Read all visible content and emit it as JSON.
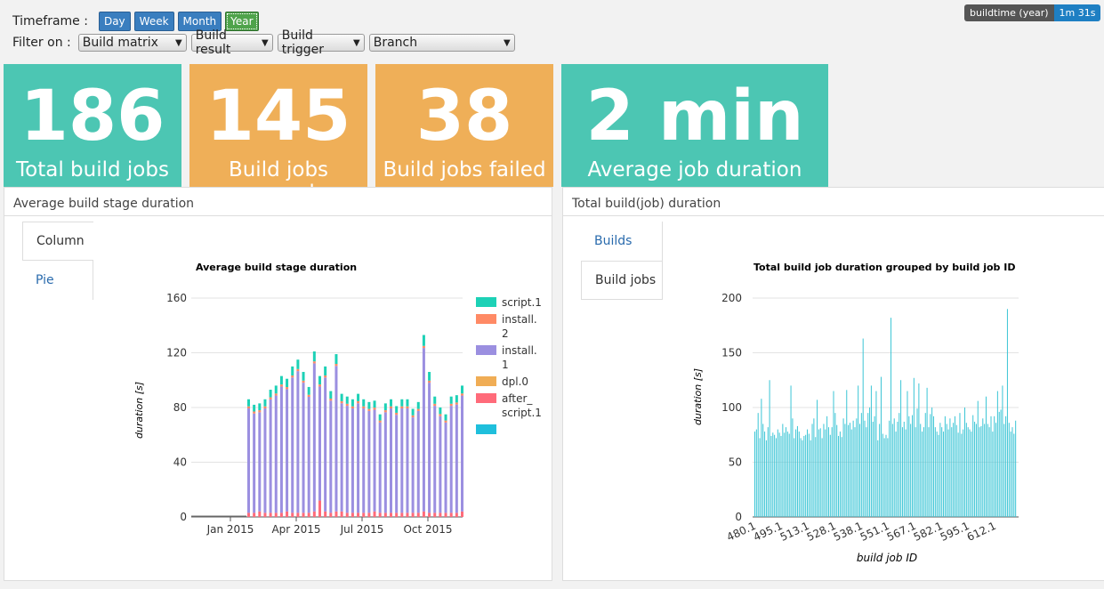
{
  "timeframe": {
    "label": "Timeframe :",
    "buttons": [
      "Day",
      "Week",
      "Month",
      "Year"
    ],
    "active": "Year"
  },
  "filter": {
    "label": "Filter on :",
    "selects": [
      "Build matrix",
      "Build result",
      "Build trigger",
      "Branch"
    ]
  },
  "badge": {
    "key": "buildtime (year)",
    "value": "1m 31s"
  },
  "tiles": [
    {
      "value": "186",
      "caption": "Total build jobs",
      "color": "#4cc6b3"
    },
    {
      "value": "145",
      "caption": "Build jobs passed",
      "color": "#efaf58"
    },
    {
      "value": "38",
      "caption": "Build jobs failed",
      "color": "#efaf58"
    },
    {
      "value": "2 min",
      "caption": "Average job duration",
      "color": "#4cc6b3"
    }
  ],
  "left_panel": {
    "title": "Average build stage duration",
    "tabs": [
      "Column",
      "Pie"
    ],
    "active_tab": "Column"
  },
  "right_panel": {
    "title": "Total build(job) duration",
    "tabs": [
      "Builds",
      "Build jobs"
    ],
    "active_tab": "Build jobs"
  },
  "chart_data": [
    {
      "type": "bar",
      "stacked": true,
      "title": "Average build stage duration",
      "ylabel": "duration [s]",
      "xlabel": "",
      "ylim": [
        0,
        160
      ],
      "yticks": [
        0,
        40,
        80,
        120,
        160
      ],
      "xticks": [
        "Jan 2015",
        "Apr 2015",
        "Jul 2015",
        "Oct 2015"
      ],
      "legend_position": "right",
      "series": [
        {
          "name": "script.1",
          "color": "#1dd1b6"
        },
        {
          "name": "install.\n2",
          "color": "#ff8a65"
        },
        {
          "name": "install.\n1",
          "color": "#9b8fe0"
        },
        {
          "name": "dpl.0",
          "color": "#f0ad55"
        },
        {
          "name": "after_\nscript.1",
          "color": "#ff6b7a"
        },
        {
          "name": "",
          "color": "#1fbfdc"
        }
      ],
      "bars": [
        [
          86,
          3
        ],
        [
          82,
          3
        ],
        [
          83,
          4
        ],
        [
          86,
          3
        ],
        [
          93,
          3
        ],
        [
          96,
          3
        ],
        [
          103,
          3
        ],
        [
          101,
          4
        ],
        [
          110,
          3
        ],
        [
          115,
          3
        ],
        [
          106,
          3
        ],
        [
          95,
          3
        ],
        [
          121,
          4
        ],
        [
          103,
          12
        ],
        [
          110,
          4
        ],
        [
          92,
          3
        ],
        [
          119,
          4
        ],
        [
          90,
          4
        ],
        [
          88,
          3
        ],
        [
          86,
          3
        ],
        [
          90,
          3
        ],
        [
          86,
          3
        ],
        [
          84,
          3
        ],
        [
          85,
          4
        ],
        [
          75,
          3
        ],
        [
          83,
          3
        ],
        [
          86,
          3
        ],
        [
          81,
          3
        ],
        [
          86,
          3
        ],
        [
          86,
          3
        ],
        [
          79,
          3
        ],
        [
          84,
          3
        ],
        [
          133,
          4
        ],
        [
          106,
          3
        ],
        [
          88,
          3
        ],
        [
          80,
          3
        ],
        [
          75,
          3
        ],
        [
          88,
          3
        ],
        [
          89,
          3
        ],
        [
          96,
          4
        ]
      ]
    },
    {
      "type": "bar",
      "title": "Total build job duration grouped by build job ID",
      "ylabel": "duration [s]",
      "xlabel": "build job ID",
      "ylim": [
        0,
        200
      ],
      "yticks": [
        0,
        50,
        100,
        150,
        200
      ],
      "xticks": [
        "480.1",
        "495.1",
        "513.1",
        "528.1",
        "538.1",
        "551.1",
        "567.1",
        "582.1",
        "595.1",
        "612.1"
      ],
      "color": "#3ec6d6",
      "values": [
        78,
        80,
        95,
        72,
        108,
        85,
        78,
        70,
        82,
        125,
        74,
        77,
        75,
        72,
        80,
        77,
        74,
        85,
        77,
        82,
        78,
        76,
        120,
        90,
        72,
        80,
        83,
        78,
        72,
        70,
        74,
        75,
        80,
        76,
        70,
        85,
        90,
        73,
        107,
        80,
        81,
        72,
        85,
        80,
        92,
        82,
        75,
        82,
        115,
        95,
        84,
        74,
        78,
        73,
        90,
        85,
        116,
        84,
        86,
        80,
        88,
        82,
        90,
        120,
        85,
        95,
        163,
        88,
        82,
        95,
        100,
        120,
        87,
        92,
        115,
        70,
        85,
        128,
        76,
        72,
        75,
        72,
        88,
        182,
        85,
        90,
        78,
        87,
        95,
        125,
        82,
        87,
        80,
        115,
        92,
        85,
        93,
        127,
        82,
        99,
        122,
        85,
        78,
        82,
        95,
        118,
        82,
        94,
        100,
        92,
        82,
        78,
        75,
        86,
        82,
        78,
        92,
        85,
        80,
        90,
        82,
        86,
        92,
        84,
        77,
        95,
        76,
        80,
        100,
        86,
        82,
        80,
        78,
        93,
        87,
        85,
        106,
        82,
        83,
        90,
        85,
        110,
        85,
        82,
        92,
        78,
        92,
        86,
        115,
        96,
        98,
        120,
        85,
        92,
        190,
        86,
        78,
        82,
        76,
        88
      ]
    }
  ]
}
